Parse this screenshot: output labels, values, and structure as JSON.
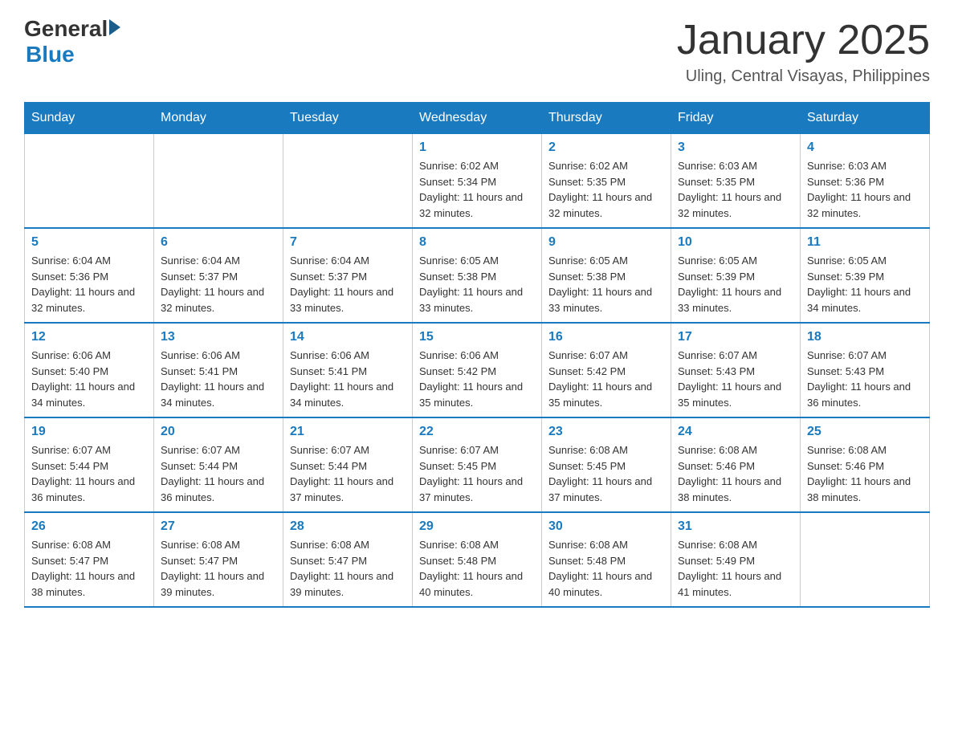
{
  "header": {
    "logo_general": "General",
    "logo_blue": "Blue",
    "month_title": "January 2025",
    "location": "Uling, Central Visayas, Philippines"
  },
  "days_of_week": [
    "Sunday",
    "Monday",
    "Tuesday",
    "Wednesday",
    "Thursday",
    "Friday",
    "Saturday"
  ],
  "weeks": [
    [
      {
        "day": "",
        "info": ""
      },
      {
        "day": "",
        "info": ""
      },
      {
        "day": "",
        "info": ""
      },
      {
        "day": "1",
        "info": "Sunrise: 6:02 AM\nSunset: 5:34 PM\nDaylight: 11 hours and 32 minutes."
      },
      {
        "day": "2",
        "info": "Sunrise: 6:02 AM\nSunset: 5:35 PM\nDaylight: 11 hours and 32 minutes."
      },
      {
        "day": "3",
        "info": "Sunrise: 6:03 AM\nSunset: 5:35 PM\nDaylight: 11 hours and 32 minutes."
      },
      {
        "day": "4",
        "info": "Sunrise: 6:03 AM\nSunset: 5:36 PM\nDaylight: 11 hours and 32 minutes."
      }
    ],
    [
      {
        "day": "5",
        "info": "Sunrise: 6:04 AM\nSunset: 5:36 PM\nDaylight: 11 hours and 32 minutes."
      },
      {
        "day": "6",
        "info": "Sunrise: 6:04 AM\nSunset: 5:37 PM\nDaylight: 11 hours and 32 minutes."
      },
      {
        "day": "7",
        "info": "Sunrise: 6:04 AM\nSunset: 5:37 PM\nDaylight: 11 hours and 33 minutes."
      },
      {
        "day": "8",
        "info": "Sunrise: 6:05 AM\nSunset: 5:38 PM\nDaylight: 11 hours and 33 minutes."
      },
      {
        "day": "9",
        "info": "Sunrise: 6:05 AM\nSunset: 5:38 PM\nDaylight: 11 hours and 33 minutes."
      },
      {
        "day": "10",
        "info": "Sunrise: 6:05 AM\nSunset: 5:39 PM\nDaylight: 11 hours and 33 minutes."
      },
      {
        "day": "11",
        "info": "Sunrise: 6:05 AM\nSunset: 5:39 PM\nDaylight: 11 hours and 34 minutes."
      }
    ],
    [
      {
        "day": "12",
        "info": "Sunrise: 6:06 AM\nSunset: 5:40 PM\nDaylight: 11 hours and 34 minutes."
      },
      {
        "day": "13",
        "info": "Sunrise: 6:06 AM\nSunset: 5:41 PM\nDaylight: 11 hours and 34 minutes."
      },
      {
        "day": "14",
        "info": "Sunrise: 6:06 AM\nSunset: 5:41 PM\nDaylight: 11 hours and 34 minutes."
      },
      {
        "day": "15",
        "info": "Sunrise: 6:06 AM\nSunset: 5:42 PM\nDaylight: 11 hours and 35 minutes."
      },
      {
        "day": "16",
        "info": "Sunrise: 6:07 AM\nSunset: 5:42 PM\nDaylight: 11 hours and 35 minutes."
      },
      {
        "day": "17",
        "info": "Sunrise: 6:07 AM\nSunset: 5:43 PM\nDaylight: 11 hours and 35 minutes."
      },
      {
        "day": "18",
        "info": "Sunrise: 6:07 AM\nSunset: 5:43 PM\nDaylight: 11 hours and 36 minutes."
      }
    ],
    [
      {
        "day": "19",
        "info": "Sunrise: 6:07 AM\nSunset: 5:44 PM\nDaylight: 11 hours and 36 minutes."
      },
      {
        "day": "20",
        "info": "Sunrise: 6:07 AM\nSunset: 5:44 PM\nDaylight: 11 hours and 36 minutes."
      },
      {
        "day": "21",
        "info": "Sunrise: 6:07 AM\nSunset: 5:44 PM\nDaylight: 11 hours and 37 minutes."
      },
      {
        "day": "22",
        "info": "Sunrise: 6:07 AM\nSunset: 5:45 PM\nDaylight: 11 hours and 37 minutes."
      },
      {
        "day": "23",
        "info": "Sunrise: 6:08 AM\nSunset: 5:45 PM\nDaylight: 11 hours and 37 minutes."
      },
      {
        "day": "24",
        "info": "Sunrise: 6:08 AM\nSunset: 5:46 PM\nDaylight: 11 hours and 38 minutes."
      },
      {
        "day": "25",
        "info": "Sunrise: 6:08 AM\nSunset: 5:46 PM\nDaylight: 11 hours and 38 minutes."
      }
    ],
    [
      {
        "day": "26",
        "info": "Sunrise: 6:08 AM\nSunset: 5:47 PM\nDaylight: 11 hours and 38 minutes."
      },
      {
        "day": "27",
        "info": "Sunrise: 6:08 AM\nSunset: 5:47 PM\nDaylight: 11 hours and 39 minutes."
      },
      {
        "day": "28",
        "info": "Sunrise: 6:08 AM\nSunset: 5:47 PM\nDaylight: 11 hours and 39 minutes."
      },
      {
        "day": "29",
        "info": "Sunrise: 6:08 AM\nSunset: 5:48 PM\nDaylight: 11 hours and 40 minutes."
      },
      {
        "day": "30",
        "info": "Sunrise: 6:08 AM\nSunset: 5:48 PM\nDaylight: 11 hours and 40 minutes."
      },
      {
        "day": "31",
        "info": "Sunrise: 6:08 AM\nSunset: 5:49 PM\nDaylight: 11 hours and 41 minutes."
      },
      {
        "day": "",
        "info": ""
      }
    ]
  ]
}
